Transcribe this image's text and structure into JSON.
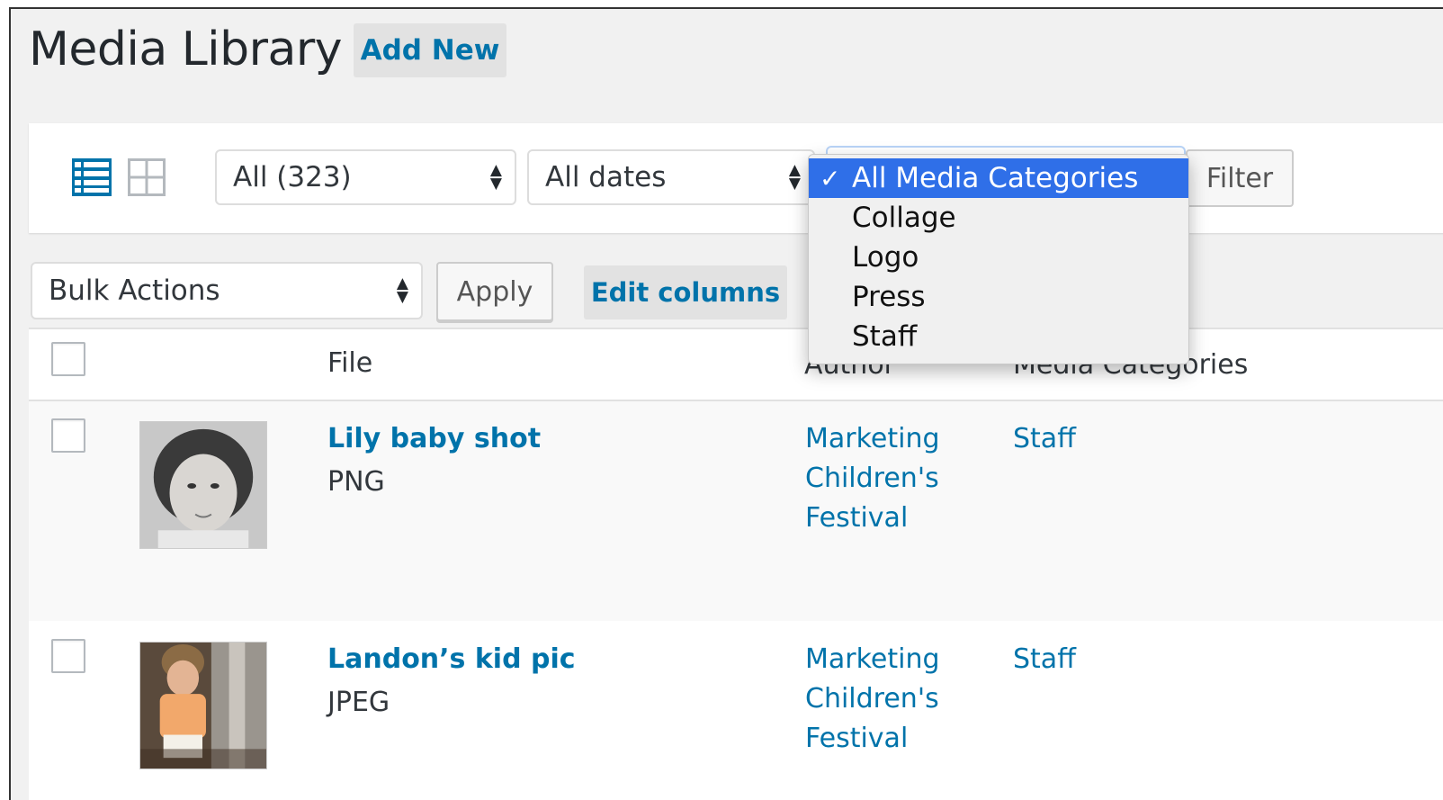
{
  "page": {
    "title": "Media Library",
    "add_new_label": "Add New"
  },
  "filters": {
    "type_select": "All (323)",
    "dates_select": "All dates",
    "category_dropdown": {
      "selected": "All Media Categories",
      "options": [
        "All Media Categories",
        "Collage",
        "Logo",
        "Press",
        "Staff"
      ]
    },
    "filter_button": "Filter"
  },
  "actions": {
    "bulk_select": "Bulk Actions",
    "apply_button": "Apply",
    "edit_columns": "Edit columns"
  },
  "table": {
    "columns": {
      "file": "File",
      "author": "Author",
      "media_categories": "Media Categories"
    },
    "rows": [
      {
        "title": "Lily baby shot",
        "type": "PNG",
        "author_lines": [
          "Marketing",
          "Children's",
          "Festival"
        ],
        "category": "Staff"
      },
      {
        "title": "Landon’s kid pic",
        "type": "JPEG",
        "author_lines": [
          "Marketing",
          "Children's",
          "Festival"
        ],
        "category": "Staff"
      }
    ]
  },
  "colors": {
    "link": "#0073aa",
    "selected_option": "#2f6fe8",
    "page_bg": "#f1f1f1"
  },
  "icons": [
    "list-view-icon",
    "grid-view-icon",
    "select-arrows-icon",
    "checkmark-icon"
  ]
}
